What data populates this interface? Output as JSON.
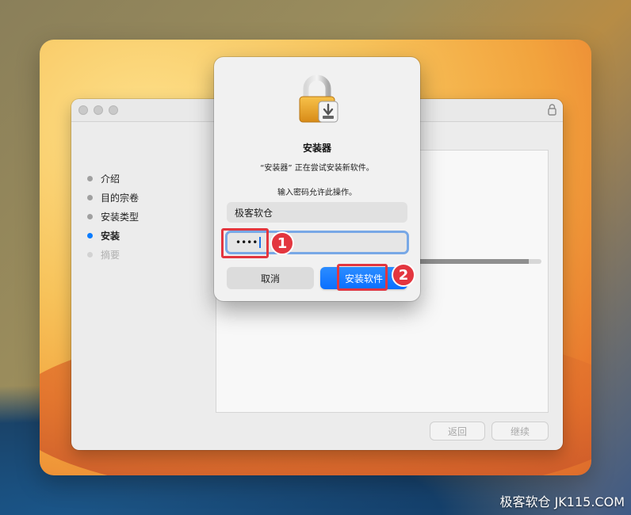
{
  "installer": {
    "steps": [
      {
        "label": "介绍",
        "state": "done"
      },
      {
        "label": "目的宗卷",
        "state": "done"
      },
      {
        "label": "安装类型",
        "state": "done"
      },
      {
        "label": "安装",
        "state": "active"
      },
      {
        "label": "摘要",
        "state": "pending"
      }
    ],
    "progress": 0.9,
    "back_label": "返回",
    "continue_label": "继续"
  },
  "auth_dialog": {
    "title": "安装器",
    "message": "“安装器” 正在尝试安装新软件。",
    "prompt": "输入密码允许此操作。",
    "username": "极客软仓",
    "password_masked": "••••",
    "cancel_label": "取消",
    "install_label": "安装软件"
  },
  "annotations": {
    "badge_1": "1",
    "badge_2": "2"
  },
  "watermark": "极客软仓 JK115.COM",
  "colors": {
    "accent": "#0a7cff",
    "annotation_red": "#e3363f"
  },
  "icons": [
    "lock-icon",
    "installer-lock-icon"
  ]
}
